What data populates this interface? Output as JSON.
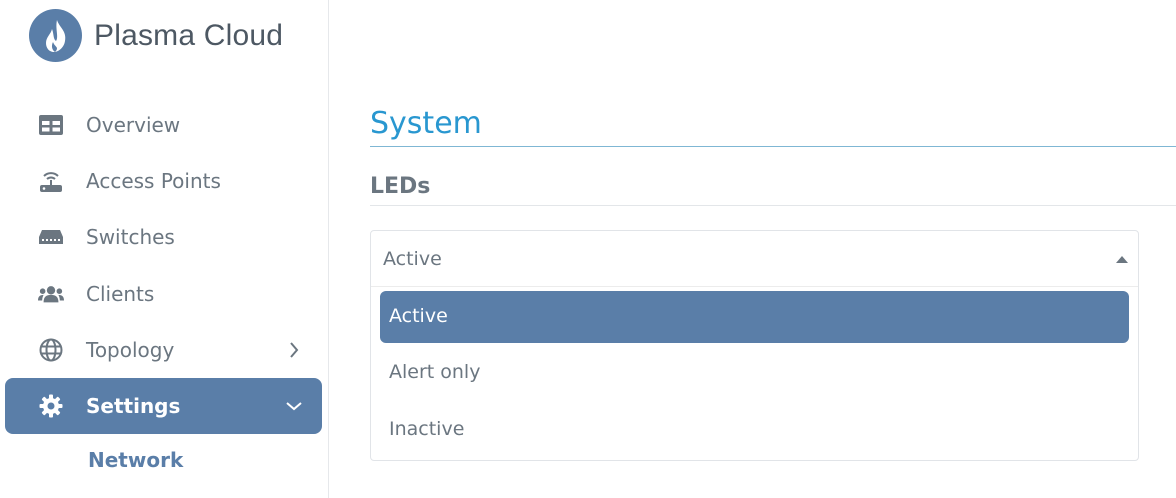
{
  "brand": {
    "name": "Plasma Cloud",
    "logo_icon": "flame-icon",
    "color": "#5a7ea8"
  },
  "sidebar": {
    "items": [
      {
        "label": "Overview",
        "icon": "dashboard-icon"
      },
      {
        "label": "Access Points",
        "icon": "access-point-icon"
      },
      {
        "label": "Switches",
        "icon": "switch-icon"
      },
      {
        "label": "Clients",
        "icon": "users-icon"
      },
      {
        "label": "Topology",
        "icon": "globe-icon",
        "chevron": "chevron-right-icon"
      },
      {
        "label": "Settings",
        "icon": "gear-icon",
        "chevron": "chevron-down-icon",
        "active": true
      }
    ],
    "subitems": [
      {
        "label": "Network"
      }
    ]
  },
  "main": {
    "title": "System",
    "section": "LEDs",
    "leds_select": {
      "value": "Active",
      "options": [
        {
          "label": "Active",
          "selected": true
        },
        {
          "label": "Alert only"
        },
        {
          "label": "Inactive"
        }
      ]
    }
  },
  "colors": {
    "accent": "#5a7ea8",
    "title": "#2997d0",
    "text": "#6b7680"
  }
}
